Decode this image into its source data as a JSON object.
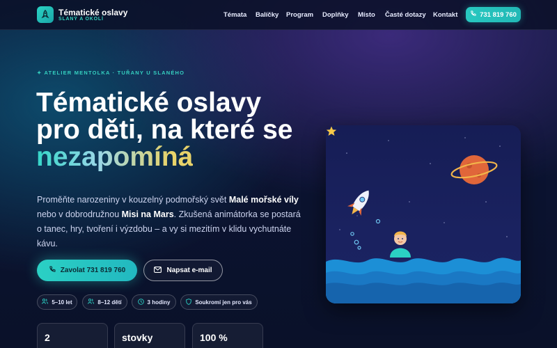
{
  "brand": {
    "title": "Tématické oslavy",
    "subtitle": "SLANÝ A OKOLÍ",
    "icon": "rocket-icon"
  },
  "nav": {
    "items": [
      {
        "label": "Témata"
      },
      {
        "label": "Balíčky"
      },
      {
        "label": "Program"
      },
      {
        "label": "Doplňky"
      },
      {
        "label": "Místo"
      },
      {
        "label": "Časté dotazy"
      },
      {
        "label": "Kontakt"
      }
    ],
    "phone": "731 819 760"
  },
  "hero": {
    "eyebrow": "✦ ATELIER MENTOLKA · TUŘANY U SLANÉHO",
    "headline_line1": "Tématické oslavy",
    "headline_line2": "pro děti, na které se",
    "headline_highlight": "nezapomíná",
    "lead_part1": "Proměňte narozeniny v kouzelný podmořský svět ",
    "lead_bold1": "Malé mořské víly",
    "lead_part2": " nebo v dobrodružnou ",
    "lead_bold2": "Misi na Mars",
    "lead_part3": ". Zkušená animátorka se postará o tanec, hry, tvoření i výzdobu – a vy si mezitím v klidu vychutnáte kávu.",
    "cta_call": "Zavolat 731 819 760",
    "cta_email": "Napsat e-mail"
  },
  "chips": [
    {
      "label": "5–10 let",
      "icon": "people-icon"
    },
    {
      "label": "8–12 dětí",
      "icon": "people-icon"
    },
    {
      "label": "3 hodiny",
      "icon": "clock-icon"
    },
    {
      "label": "Soukromí jen pro vás",
      "icon": "shield-icon"
    }
  ],
  "stats": [
    {
      "value": "2"
    },
    {
      "value": "stovky"
    },
    {
      "value": "100 %"
    }
  ],
  "colors": {
    "accent": "#2bd0c4",
    "gold": "#e8d36a",
    "background": "#0e1838"
  }
}
